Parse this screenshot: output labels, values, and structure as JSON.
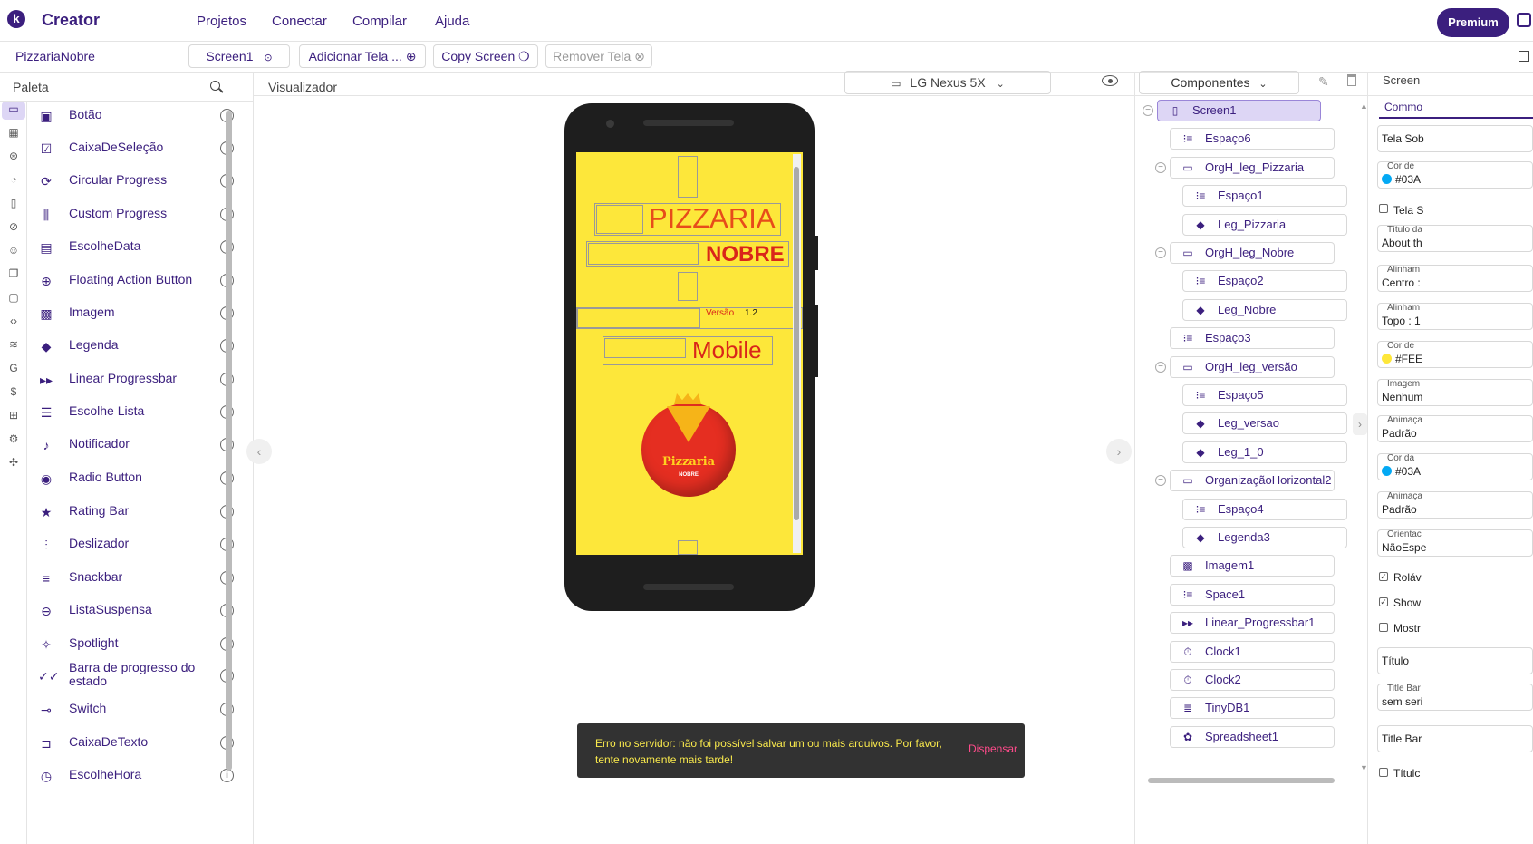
{
  "topbar": {
    "logo_letter": "k",
    "app_title": "Creator",
    "menu": [
      "Projetos",
      "Conectar",
      "Compilar",
      "Ajuda"
    ],
    "premium_label": "Premium"
  },
  "toolbar": {
    "project_name": "PizzariaNobre",
    "screen_select": "Screen1",
    "add_screen": "Adicionar Tela ...",
    "copy_screen": "Copy Screen",
    "remove_screen": "Remover Tela"
  },
  "palette": {
    "title": "Paleta",
    "items": [
      {
        "label": "Botão",
        "icon": "button-icon"
      },
      {
        "label": "CaixaDeSeleção",
        "icon": "checkbox-icon"
      },
      {
        "label": "Circular Progress",
        "icon": "circular-progress-icon"
      },
      {
        "label": "Custom Progress",
        "icon": "custom-progress-icon"
      },
      {
        "label": "EscolheData",
        "icon": "date-picker-icon"
      },
      {
        "label": "Floating Action Button",
        "icon": "fab-icon"
      },
      {
        "label": "Imagem",
        "icon": "image-icon"
      },
      {
        "label": "Legenda",
        "icon": "label-icon"
      },
      {
        "label": "Linear Progressbar",
        "icon": "linear-progress-icon"
      },
      {
        "label": "Escolhe Lista",
        "icon": "list-picker-icon"
      },
      {
        "label": "Notificador",
        "icon": "bell-icon"
      },
      {
        "label": "Radio Button",
        "icon": "radio-icon"
      },
      {
        "label": "Rating Bar",
        "icon": "star-icon"
      },
      {
        "label": "Deslizador",
        "icon": "slider-icon"
      },
      {
        "label": "Snackbar",
        "icon": "snackbar-icon"
      },
      {
        "label": "ListaSuspensa",
        "icon": "dropdown-icon"
      },
      {
        "label": "Spotlight",
        "icon": "spotlight-icon"
      },
      {
        "label": "Barra de progresso do estado",
        "icon": "state-progress-icon"
      },
      {
        "label": "Switch",
        "icon": "switch-icon"
      },
      {
        "label": "CaixaDeTexto",
        "icon": "textbox-icon"
      },
      {
        "label": "EscolheHora",
        "icon": "time-picker-icon"
      }
    ]
  },
  "viewer": {
    "title": "Visualizador",
    "device": "LG Nexus 5X",
    "app_screen": {
      "pizzaria": "PIZZARIA",
      "nobre": "NOBRE",
      "versao_label": "Versão",
      "versao_value": "1.2",
      "mobile": "Mobile",
      "logo_text": "Pizzaria",
      "logo_sub": "NOBRE"
    }
  },
  "components": {
    "title": "Componentes",
    "tree": [
      {
        "label": "Screen1",
        "icon": "phone-icon",
        "selected": true
      },
      {
        "label": "Espaço6",
        "icon": "space-icon"
      },
      {
        "label": "OrgH_leg_Pizzaria",
        "icon": "hbox-icon"
      },
      {
        "label": "Espaço1",
        "icon": "space-icon"
      },
      {
        "label": "Leg_Pizzaria",
        "icon": "label-icon"
      },
      {
        "label": "OrgH_leg_Nobre",
        "icon": "hbox-icon"
      },
      {
        "label": "Espaço2",
        "icon": "space-icon"
      },
      {
        "label": "Leg_Nobre",
        "icon": "label-icon"
      },
      {
        "label": "Espaço3",
        "icon": "space-icon"
      },
      {
        "label": "OrgH_leg_versão",
        "icon": "hbox-icon"
      },
      {
        "label": "Espaço5",
        "icon": "space-icon"
      },
      {
        "label": "Leg_versao",
        "icon": "label-icon"
      },
      {
        "label": "Leg_1_0",
        "icon": "label-icon"
      },
      {
        "label": "OrganizaçãoHorizontal2",
        "icon": "hbox-icon"
      },
      {
        "label": "Espaço4",
        "icon": "space-icon"
      },
      {
        "label": "Legenda3",
        "icon": "label-icon"
      },
      {
        "label": "Imagem1",
        "icon": "image-icon"
      },
      {
        "label": "Space1",
        "icon": "space-icon"
      },
      {
        "label": "Linear_Progressbar1",
        "icon": "linear-progress-icon"
      },
      {
        "label": "Clock1",
        "icon": "clock-icon"
      },
      {
        "label": "Clock2",
        "icon": "clock-icon"
      },
      {
        "label": "TinyDB1",
        "icon": "database-icon"
      },
      {
        "label": "Spreadsheet1",
        "icon": "spreadsheet-icon"
      }
    ]
  },
  "properties": {
    "header": "Screen",
    "tab": "Commo",
    "fields": {
      "about": "Tela Sob",
      "cor_de_label": "Cor de",
      "cor_de_value": "#03A",
      "tela_s": "Tela S",
      "titulo_da_label": "Título da",
      "titulo_da_value": "About th",
      "alinham_h_label": "Alinham",
      "alinham_h_value": "Centro :",
      "alinham_v_label": "Alinham",
      "alinham_v_value": "Topo : 1",
      "cor_fundo_label": "Cor de",
      "cor_fundo_value": "#FEE",
      "imagem_label": "Imagem",
      "imagem_value": "Nenhum",
      "animacao1_label": "Animaça",
      "animacao1_value": "Padrão",
      "cor_da_label": "Cor da",
      "cor_da_value": "#03A",
      "animacao2_label": "Animaça",
      "animacao2_value": "Padrão",
      "orientac_label": "Orientac",
      "orientac_value": "NãoEspe",
      "rolavel": "Roláv",
      "show": "Show",
      "mostr": "Mostr",
      "titulo_field": "Título",
      "title_bar_label": "Title Bar",
      "title_bar_value": "sem seri",
      "title_bar2": "Title Bar",
      "titulo_cb": "Títulc"
    },
    "colors": {
      "accent_blue": "#03A9F4",
      "yellow": "#FEE73A"
    }
  },
  "snackbar": {
    "message": "Erro no servidor: não foi possível salvar um ou mais arquivos. Por favor, tente novamente mais tarde!",
    "action": "Dispensar"
  },
  "colors": {
    "brand": "#3b1f7e",
    "screen_bg": "#fde73a",
    "title_red": "#e63322"
  }
}
